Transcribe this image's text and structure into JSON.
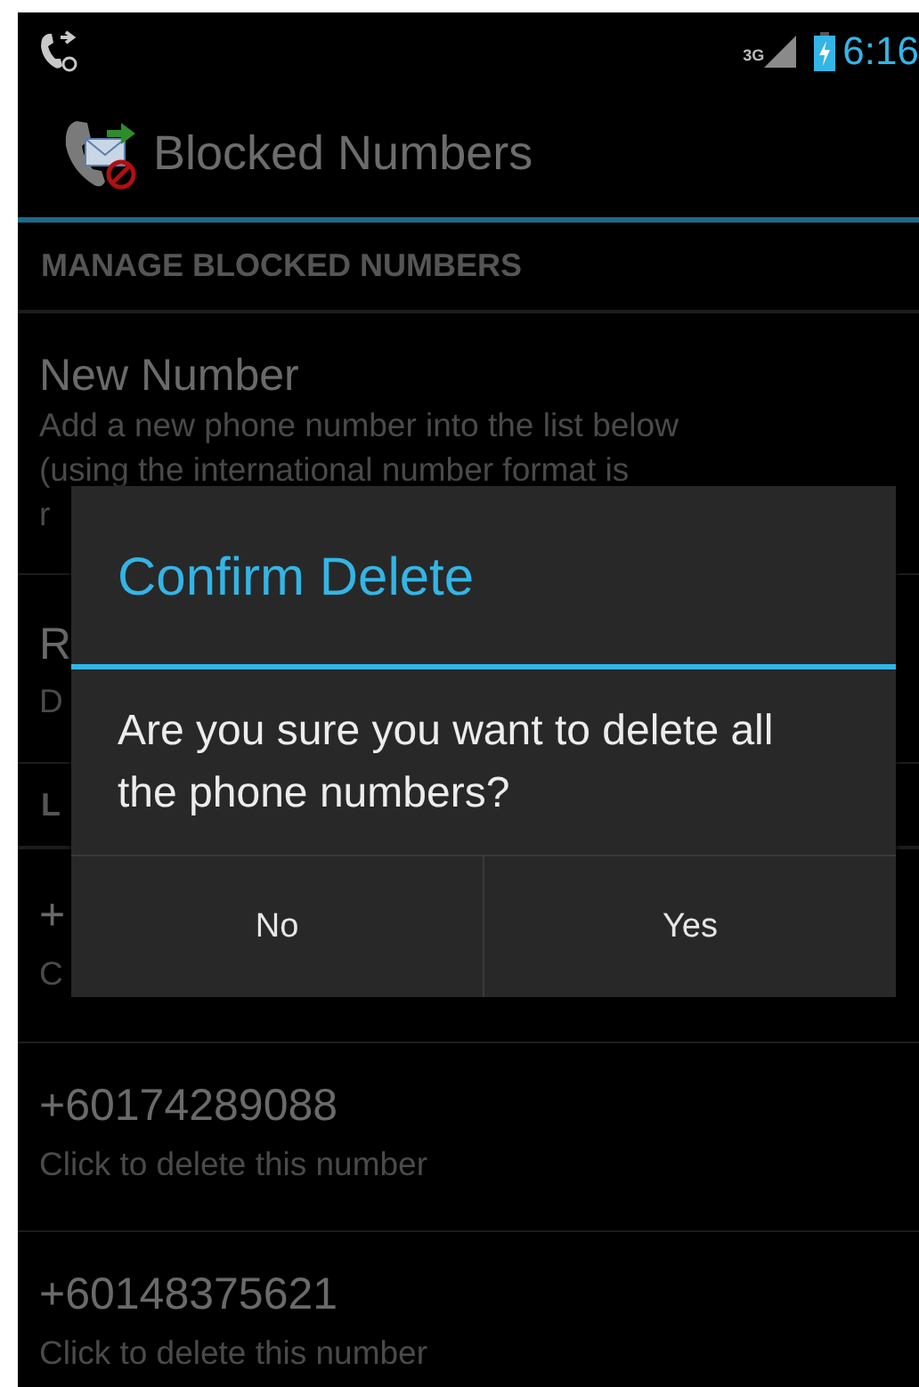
{
  "status_bar": {
    "network": "3G",
    "time": "6:16"
  },
  "action_bar": {
    "title": "Blocked Numbers"
  },
  "sections": [
    {
      "header": "MANAGE BLOCKED NUMBERS",
      "items": [
        {
          "title": "New Number",
          "summary_lines": [
            "Add a new phone number into the list below",
            "(using the international number format is",
            "r"
          ]
        },
        {
          "title": "R",
          "summary_lines": [
            "D"
          ]
        }
      ]
    },
    {
      "header": "L",
      "items": [
        {
          "title": "+",
          "summary_lines": [
            "C"
          ]
        },
        {
          "title": "+60174289088",
          "summary_lines": [
            "Click to delete this number"
          ]
        },
        {
          "title": "+60148375621",
          "summary_lines": [
            "Click to delete this number"
          ]
        }
      ]
    }
  ],
  "dialog": {
    "title": "Confirm Delete",
    "message": "Are you sure you want to delete all the phone numbers?",
    "buttons": [
      "No",
      "Yes"
    ]
  }
}
